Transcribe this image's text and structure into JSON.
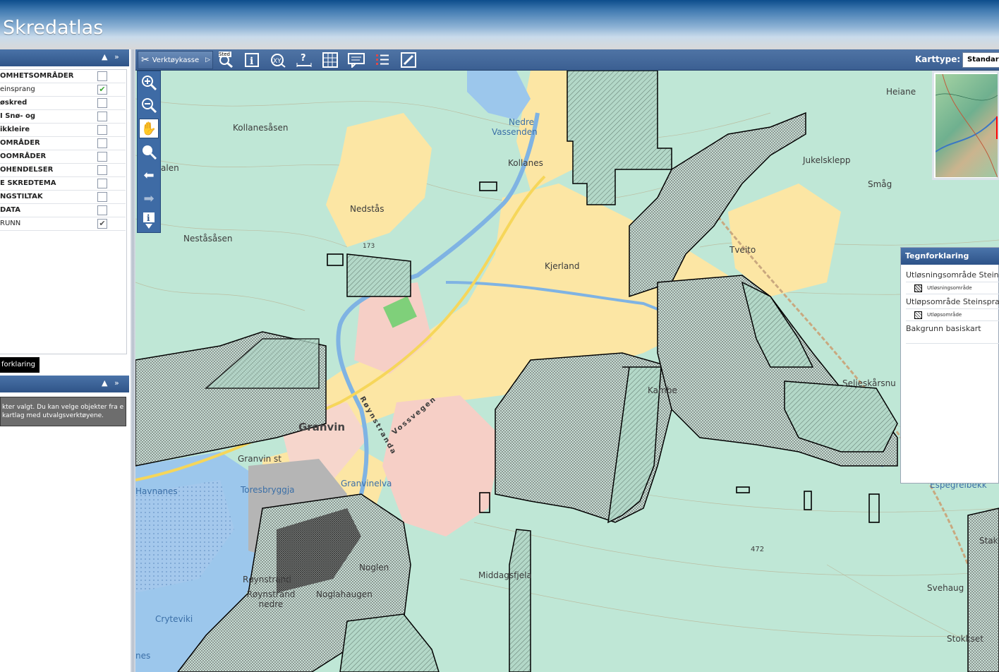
{
  "app": {
    "title": "Skredatlas"
  },
  "toolbar": {
    "toolkit_label": "Verktøykasse",
    "tools": [
      {
        "icon": "search-place-icon",
        "label": "Sted"
      },
      {
        "icon": "info-icon"
      },
      {
        "icon": "xy-coordinate-icon"
      },
      {
        "icon": "measure-icon"
      },
      {
        "icon": "grid-icon"
      },
      {
        "icon": "comment-icon"
      },
      {
        "icon": "list-icon"
      },
      {
        "icon": "draw-icon"
      }
    ],
    "map_type_label": "Karttype:",
    "map_type_value": "Standard"
  },
  "left_panel": {
    "layers": [
      {
        "label": "OMHETSOMRÅDER",
        "checked": false
      },
      {
        "label": "einsprang",
        "checked": true,
        "check_color": "#3aa630"
      },
      {
        "label": "øskred",
        "checked": false
      },
      {
        "label": "I Snø- og",
        "checked": false
      },
      {
        "label": "ikkleire",
        "checked": false
      },
      {
        "label": "OMRÅDER",
        "checked": false
      },
      {
        "label": "OOMRÅDER",
        "checked": false
      },
      {
        "label": "OHENDELSER",
        "checked": false
      },
      {
        "label": "E SKREDTEMA",
        "checked": false
      },
      {
        "label": "NGSTILTAK",
        "checked": false
      },
      {
        "label": "DATA",
        "checked": false
      },
      {
        "label": "RUNN",
        "checked": true,
        "check_color": "#555555"
      }
    ],
    "legend_button": "forklaring",
    "selection_message": "kter valgt. Du kan velge objekter fra e kartlag med utvalgsverktøyene."
  },
  "map": {
    "labels": [
      {
        "text": "Kollanesåsen",
        "type": "place"
      },
      {
        "text": "Nedre Vassenden",
        "type": "water"
      },
      {
        "text": "Kollanes",
        "type": "place"
      },
      {
        "text": "Nedstås",
        "type": "place"
      },
      {
        "text": "Neståsåsen",
        "type": "place"
      },
      {
        "text": "173",
        "type": "height"
      },
      {
        "text": "Kjerland",
        "type": "place"
      },
      {
        "text": "Tveito",
        "type": "place"
      },
      {
        "text": "Heiane",
        "type": "place"
      },
      {
        "text": "Jukelsklepp",
        "type": "place"
      },
      {
        "text": "Småg",
        "type": "place"
      },
      {
        "text": "alen",
        "type": "place"
      },
      {
        "text": "Granvin",
        "type": "town"
      },
      {
        "text": "Granvin st",
        "type": "place"
      },
      {
        "text": "Røynstranda",
        "type": "road"
      },
      {
        "text": "Vossvegen",
        "type": "road"
      },
      {
        "text": "Granvinelva",
        "type": "water"
      },
      {
        "text": "Toresbryggja",
        "type": "water"
      },
      {
        "text": "Havnanes",
        "type": "water"
      },
      {
        "text": "Røynstrand",
        "type": "place"
      },
      {
        "text": "Røynstrand nedre",
        "type": "place"
      },
      {
        "text": "Noglen",
        "type": "place"
      },
      {
        "text": "Noglahaugen",
        "type": "place"
      },
      {
        "text": "Cryteviki",
        "type": "water"
      },
      {
        "text": "Middagsfjela",
        "type": "place"
      },
      {
        "text": "Kambe",
        "type": "place"
      },
      {
        "text": "472",
        "type": "height"
      },
      {
        "text": "Seljeskårsnu",
        "type": "place"
      },
      {
        "text": "Stak",
        "type": "place"
      },
      {
        "text": "Svehaug",
        "type": "place"
      },
      {
        "text": "Stokkset",
        "type": "place"
      },
      {
        "text": "nes",
        "type": "water"
      },
      {
        "text": "Espegrelbekk",
        "type": "water"
      }
    ]
  },
  "legend": {
    "title": "Tegnforklaring",
    "groups": [
      {
        "title": "Utløsningsområde Steins",
        "item": "Utløsningsområde"
      },
      {
        "title": "Utløpsområde Steinspra",
        "item": "Utløpsområde"
      },
      {
        "title": "Bakgrunn basiskart",
        "item": ""
      }
    ]
  },
  "colors": {
    "header_top": "#0d4d8c",
    "toolbar": "#3b5f92",
    "map_green": "#bfe7d6",
    "map_yellow": "#fce6a4",
    "map_water": "#9cc7ec",
    "hazard_outline": "#000000"
  }
}
